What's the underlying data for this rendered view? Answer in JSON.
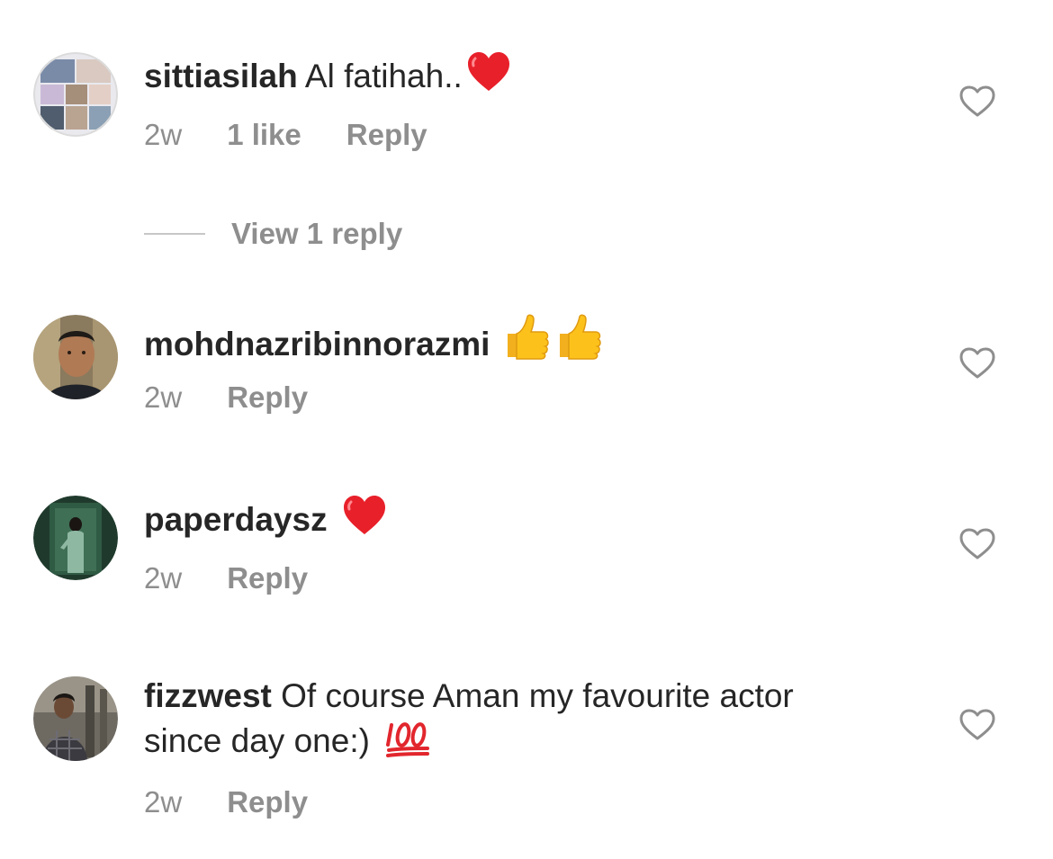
{
  "comments": [
    {
      "username": "sittiasilah",
      "text": " Al fatihah..",
      "emoji": "red-heart",
      "time": "2w",
      "likes": "1 like",
      "reply": "Reply",
      "view_replies": "View 1 reply"
    },
    {
      "username": "mohdnazribinnorazmi",
      "text": "",
      "emoji": "two-thumbs-up",
      "time": "2w",
      "reply": "Reply"
    },
    {
      "username": "paperdaysz",
      "text": "",
      "emoji": "red-heart",
      "time": "2w",
      "reply": "Reply"
    },
    {
      "username": "fizzwest",
      "text": " Of course Aman my favourite actor since day one:)",
      "emoji": "hundred-points",
      "time": "2w",
      "reply": "Reply"
    }
  ],
  "colors": {
    "text": "#262626",
    "muted": "#8e8e8e",
    "heart_emoji": "#e8202a",
    "like_outline": "#8e8e8e"
  }
}
